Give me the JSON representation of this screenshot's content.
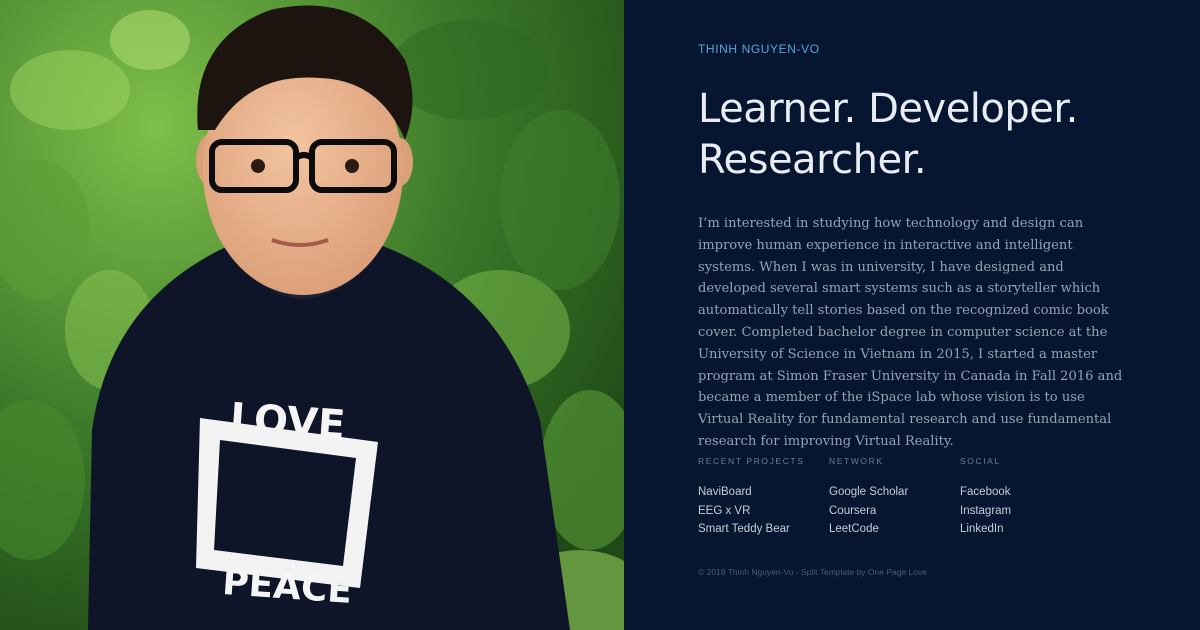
{
  "photo": {
    "alt": "Portrait of Thinh Nguyen-Vo"
  },
  "header": {
    "name": "THINH NGUYEN-VO"
  },
  "headline": {
    "line1": "Learner. Developer.",
    "line2": "Researcher."
  },
  "bio": "I’m interested in studying how technology and design can improve human experience in interactive and intelligent systems. When I was in university, I have designed and developed several smart systems such as a storyteller which automatically tell stories based on the recognized comic book cover. Completed bachelor degree in computer science at the University of Science in Vietnam in 2015, I started a master program at Simon Fraser University in Canada in Fall 2016 and became a member of the iSpace lab whose vision is to use Virtual Reality for fundamental research and use fundamental research for improving Virtual Reality.",
  "sections": {
    "projects": {
      "title": "RECENT PROJECTS",
      "links": [
        "NaviBoard",
        "EEG x VR",
        "Smart Teddy Bear"
      ]
    },
    "network": {
      "title": "NETWORK",
      "links": [
        "Google Scholar",
        "Coursera",
        "LeetCode"
      ]
    },
    "social": {
      "title": "SOCIAL",
      "links": [
        "Facebook",
        "Instagram",
        "LinkedIn"
      ]
    }
  },
  "footer": "© 2018 Thinh Nguyen-Vo - Split Template by One Page Love",
  "colors": {
    "background": "#071630",
    "accent": "#57a6d6",
    "headline": "#e9edf3",
    "body_text": "#94a2b6"
  }
}
